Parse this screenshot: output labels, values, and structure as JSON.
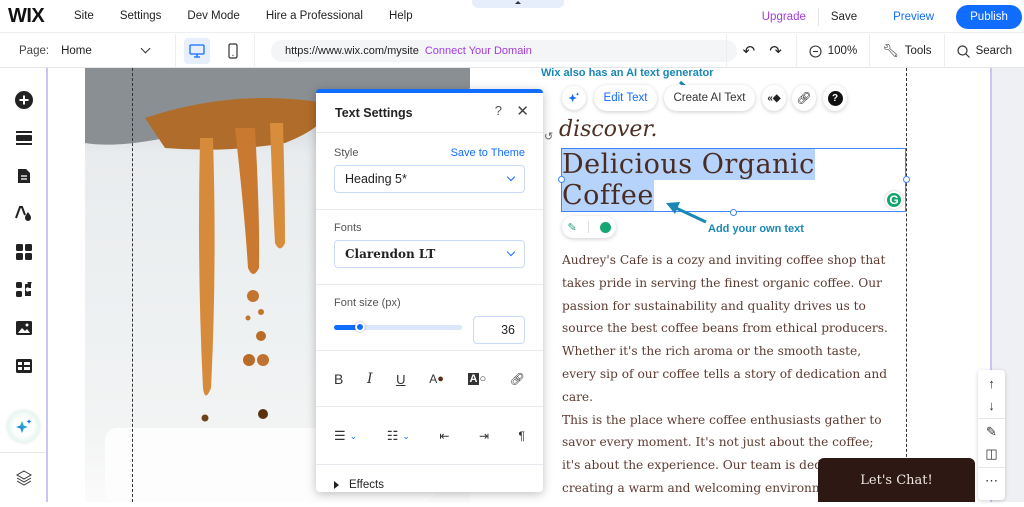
{
  "topbar": {
    "logo": "WIX",
    "menu": [
      "Site",
      "Settings",
      "Dev Mode",
      "Hire a Professional",
      "Help"
    ],
    "upgrade": "Upgrade",
    "save": "Save",
    "preview": "Preview",
    "publish": "Publish"
  },
  "toolbar": {
    "page_label": "Page:",
    "page_value": "Home",
    "url": "https://www.wix.com/mysite",
    "connect_domain": "Connect Your Domain",
    "zoom": "100%",
    "tools": "Tools",
    "search": "Search"
  },
  "text_settings": {
    "title": "Text Settings",
    "help": "?",
    "close": "✕",
    "style_label": "Style",
    "save_to_theme": "Save to Theme",
    "style_value": "Heading 5*",
    "fonts_label": "Fonts",
    "font_value": "Clarendon LT",
    "font_size_label": "Font size (px)",
    "font_size_value": "36",
    "font_size_slider_fraction": 0.2,
    "effects": "Effects"
  },
  "annotations": {
    "ai_generator": "Wix also has an AI text generator",
    "own_text": "Add your own text"
  },
  "float_toolbar": {
    "edit_text": "Edit Text",
    "create_ai_text": "Create AI Text"
  },
  "site": {
    "tagline": "discover.",
    "heading_line1": "Delicious Organic",
    "heading_line2": "Coffee",
    "paragraph1": "Audrey's Cafe is a cozy and inviting coffee shop that takes pride in serving the finest organic coffee. Our passion for sustainability and quality drives us to source the best coffee beans from ethical producers. Whether it's the rich aroma or the smooth taste, every sip of our coffee tells a story of dedication and care.",
    "paragraph2": "This is the place where coffee enthusiasts gather to savor every moment. It's not just about the coffee; it's about the experience. Our team is dedicated to creating a warm and welcoming environment",
    "chat_button": "Let's Chat!"
  },
  "colors": {
    "accent": "#116dff",
    "upgrade": "#a23cd9",
    "annotation": "#1a87b5",
    "heading": "#4a2c22",
    "chat_bg": "#2d1813"
  }
}
